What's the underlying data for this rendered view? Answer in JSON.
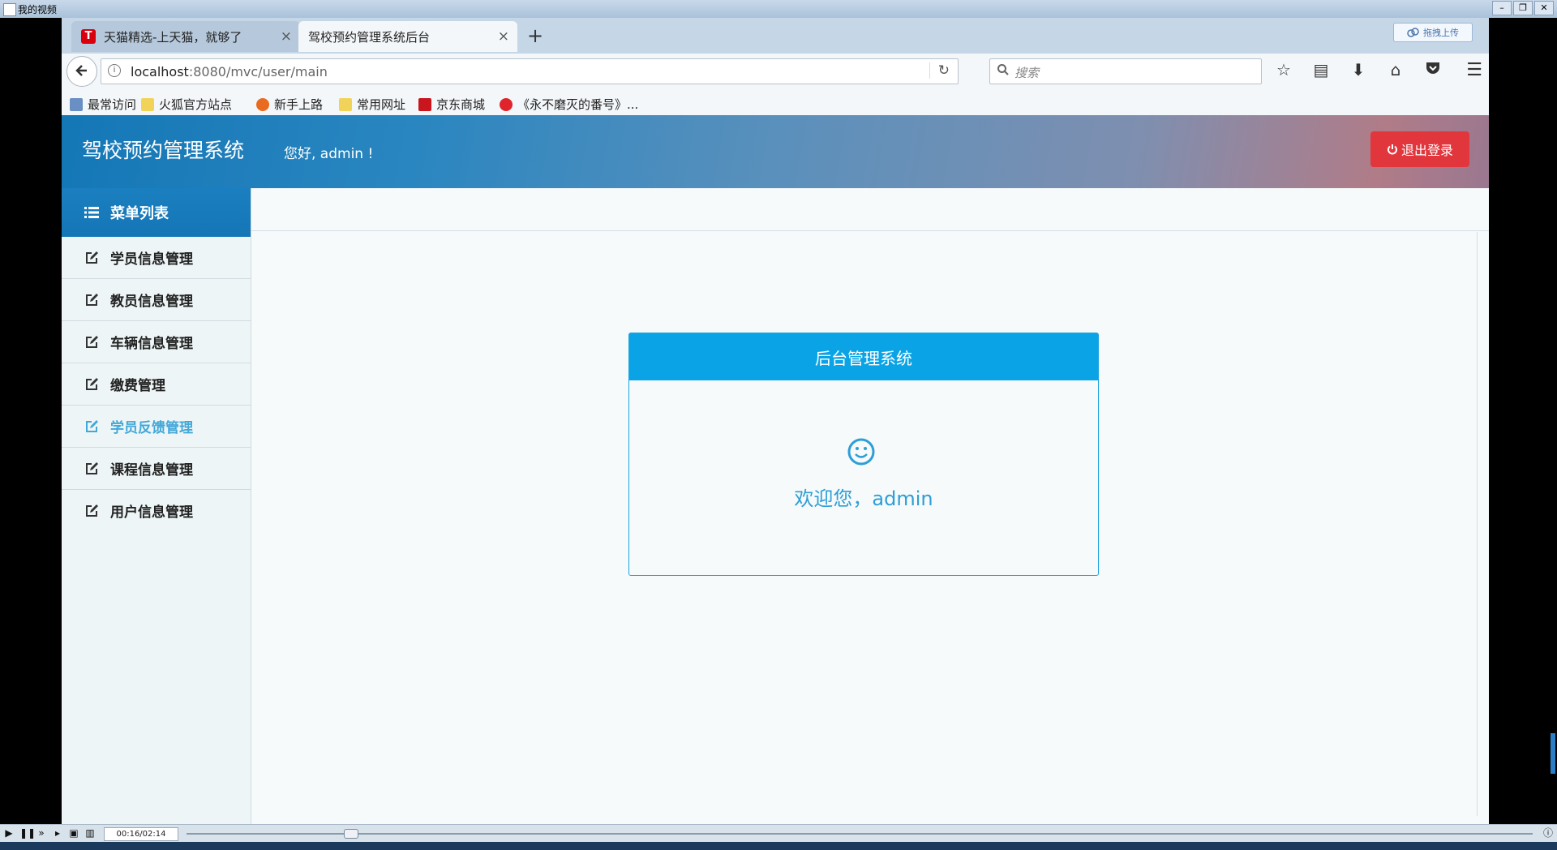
{
  "player": {
    "title": "我的视频",
    "time": "00:16/02:14",
    "window_buttons": [
      "–",
      "❐",
      "✕"
    ]
  },
  "browser": {
    "tabs": [
      {
        "title": "天猫精选-上天猫，就够了",
        "favicon": "T",
        "active": false
      },
      {
        "title": "驾校预约管理系统后台",
        "active": true
      }
    ],
    "new_tab": "+",
    "upload_label": "拖拽上传",
    "url_host": "localhost",
    "url_rest": ":8080/mvc/user/main",
    "search_placeholder": "搜索",
    "bookmarks": [
      "最常访问",
      "火狐官方站点",
      "新手上路",
      "常用网址",
      "京东商城",
      "《永不磨灭的番号》..."
    ]
  },
  "app": {
    "title": "驾校预约管理系统",
    "greeting": "您好, admin !",
    "logout": "退出登录",
    "menu_title": "菜单列表",
    "menu_items": [
      "学员信息管理",
      "教员信息管理",
      "车辆信息管理",
      "缴费管理",
      "学员反馈管理",
      "课程信息管理",
      "用户信息管理"
    ],
    "active_menu_index": 4,
    "card_title": "后台管理系统",
    "welcome": "欢迎您，admin"
  },
  "colors": {
    "header_blue": "#1477b6",
    "logout_red": "#e2363d",
    "card_blue": "#0aa4e6",
    "welcome_text": "#2e9ed6",
    "active_menu": "#42a8d8"
  },
  "icons": {
    "back": "arrow-left-icon",
    "reload": "reload-icon",
    "search": "search-icon",
    "bookmark_star": "star-icon",
    "reader": "reader-icon",
    "download": "download-icon",
    "home": "home-icon",
    "pocket": "pocket-icon",
    "menu": "hamburger-icon",
    "power": "power-icon",
    "list": "list-icon",
    "edit": "edit-icon",
    "smile": "smile-icon"
  }
}
